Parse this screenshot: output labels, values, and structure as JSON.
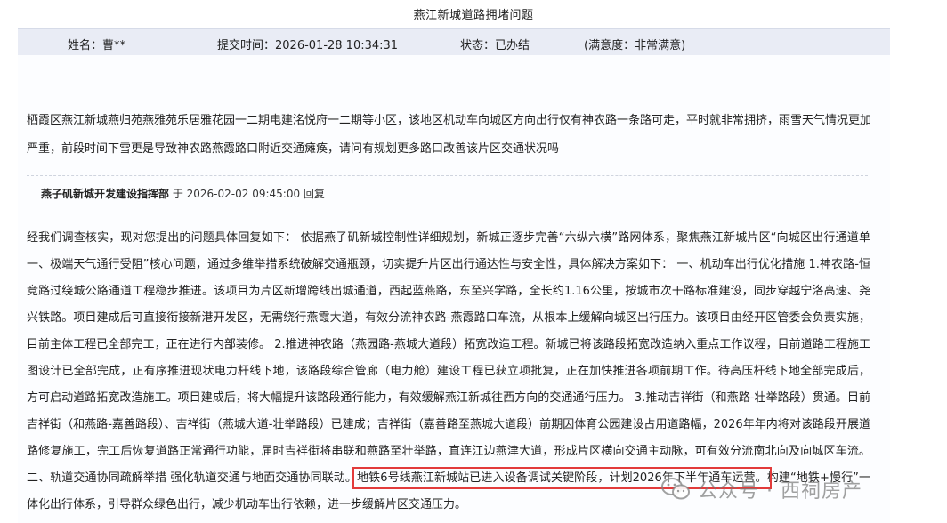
{
  "page": {
    "title": "燕江新城道路拥堵问题"
  },
  "info": {
    "name": "姓名：曹**",
    "submit_time": "提交时间：2026-01-28 10:34:31",
    "status": "状态：已办结",
    "satisfaction": "(满意度：非常满意)"
  },
  "question": {
    "text": "栖霞区燕江新城燕归苑燕雅苑乐居雅花园一二期电建洺悦府一二期等小区，该地区机动车向城区方向出行仅有神农路一条路可走，平时就非常拥挤，雨雪天气情况更加严重，前段时间下雪更是导致神农路燕霞路口附近交通瘫痪，请问有规划更多路口改善该片区交通状况吗"
  },
  "reply": {
    "org": "燕子矶新城开发建设指挥部",
    "meta": " 于 2026-02-02 09:45:00 回复",
    "body_before": "经我们调查核实，现对您提出的问题具体回复如下：  依据燕子矶新城控制性详细规划，新城正逐步完善“六纵六横”路网体系，聚焦燕江新城片区“向城区出行通道单一、极端天气通行受阻”核心问题，通过多维举措系统破解交通瓶颈，切实提升片区出行通达性与安全性，具体解决方案如下：  一、机动车出行优化措施 1.神农路-恒竞路过绕城公路通道工程稳步推进。该项目为片区新增跨线出城通道，西起蓝燕路，东至兴学路，全长约1.16公里，按城市次干路标准建设，同步穿越宁洛高速、尧兴铁路。项目建成后可直接衔接新港开发区，无需绕行燕霞大道，有效分流神农路-燕霞路口车流，从根本上缓解向城区出行压力。该项目由经开区管委会负责实施，目前主体工程已全部完工，正在进行内部装修。  2.推进神农路（燕园路-燕城大道段）拓宽改造工程。新城已将该路段拓宽改造纳入重点工作议程，目前道路工程施工图设计已全部完成，正有序推进现状电力杆线下地，该路段综合管廊（电力舱）建设工程已获立项批复，正在加快推进各项前期工作。待高压杆线下地全部完成后，方可启动道路拓宽改造施工。项目建成后，将大幅提升该路段通行能力，有效缓解燕江新城往西方向的交通通行压力。  3.推动吉祥街（和燕路-壮举路段）贯通。目前吉祥街（和燕路-嘉善路段）、吉祥街（燕城大道-壮举路段）已建成；吉祥街（嘉善路至燕城大道段）前期因体育公园建设占用道路幅，2026年年内将对该路段开展道路修复施工，完工后恢复道路正常通行功能，届时吉祥街将串联和燕路至壮举路，直连江边燕津大道，形成片区横向交通主动脉，可有效分流南北向及向城区车流。  二、轨道交通协同疏解举措 强化轨道交通与地面交通协同联动。",
    "body_highlight": "地铁6号线燕江新城站已进入设备调试关键阶段，计划2026年下半年通车运营。",
    "body_after": "构建“地铁+慢行”一体化出行体系，引导群众绿色出行，减少机动车出行依赖，进一步缓解片区交通压力。"
  },
  "watermark": {
    "text": "公众号 · 西祠房产",
    "icon": "wechat-icon"
  }
}
